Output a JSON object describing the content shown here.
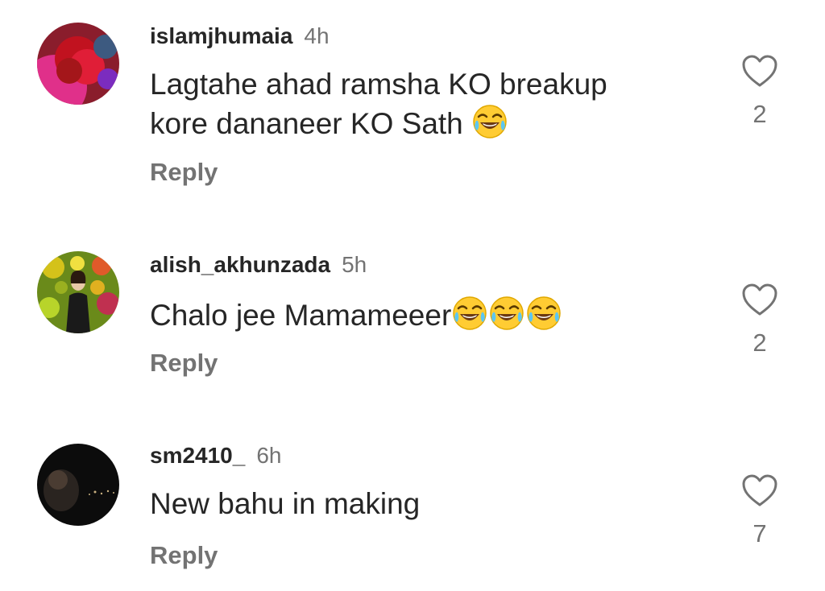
{
  "comments": [
    {
      "username": "islamjhumaia",
      "time": "4h",
      "text": "Lagtahe ahad ramsha KO breakup",
      "text_line2": "kore dananeer KO Sath",
      "emoji_count": 1,
      "reply_label": "Reply",
      "likes": "2"
    },
    {
      "username": "alish_akhunzada",
      "time": "5h",
      "text": "Chalo jee Mamameeer",
      "emoji_count": 3,
      "reply_label": "Reply",
      "likes": "2"
    },
    {
      "username": "sm2410_",
      "time": "6h",
      "text": "New bahu in making",
      "reply_label": "Reply",
      "likes": "7"
    }
  ],
  "icons": {
    "like": "heart-outline-icon",
    "emoji": "face-with-tears-of-joy"
  },
  "colors": {
    "text": "#262626",
    "secondary": "#737373"
  }
}
